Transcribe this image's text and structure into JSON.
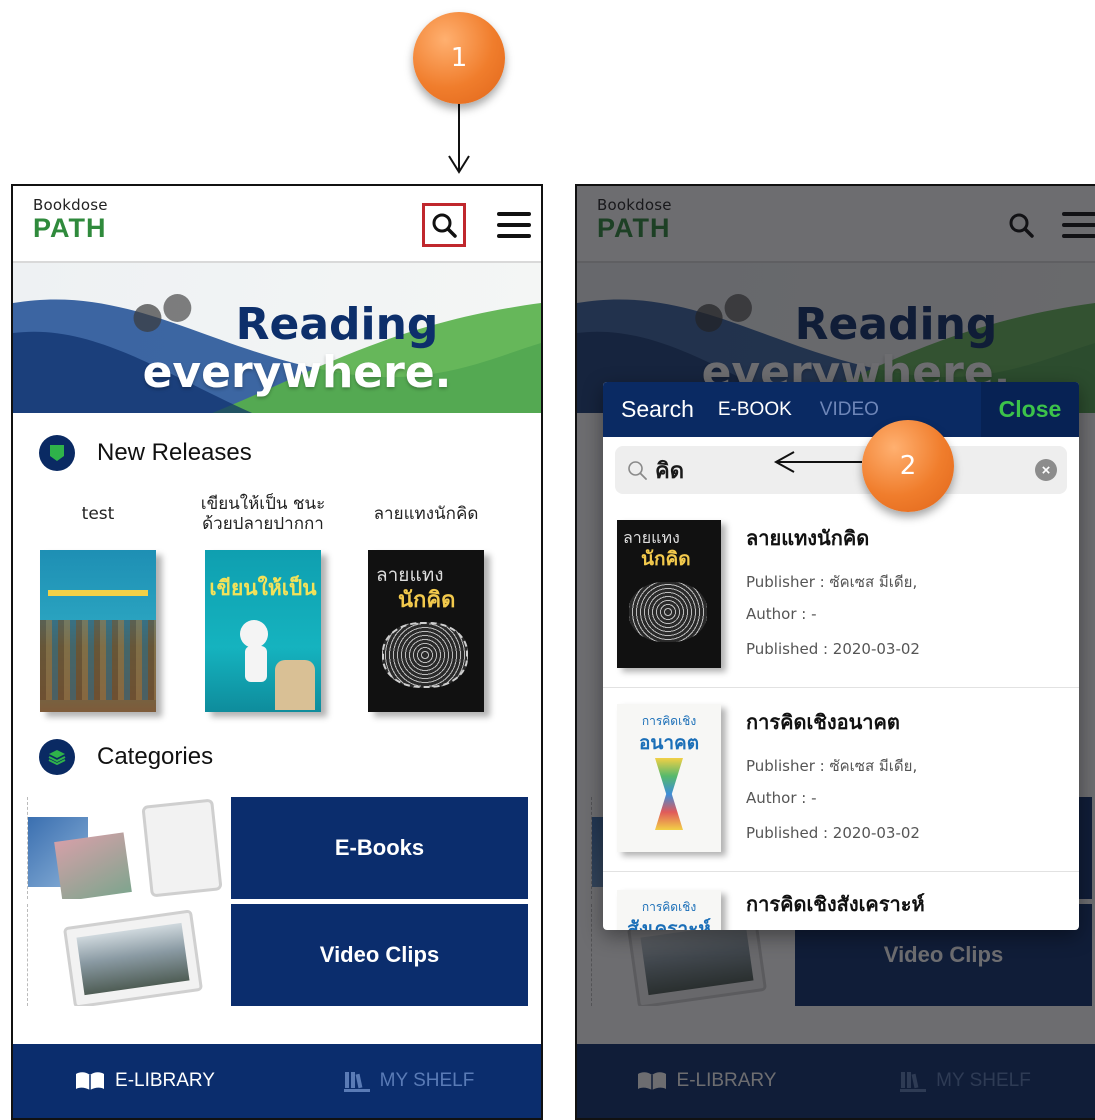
{
  "markers": {
    "step1": "1",
    "step2": "2"
  },
  "app": {
    "logo_top": "Bookdose",
    "logo_main": "PATH",
    "banner_line1": "Reading",
    "banner_line2": "everywhere."
  },
  "new_releases": {
    "heading": "New Releases",
    "books": [
      {
        "title": "test"
      },
      {
        "title": "เขียนให้เป็น ชนะด้วยปลายปากกา",
        "cover_text": "เขียนให้เป็น"
      },
      {
        "title": "ลายแทงนักคิด",
        "cover_text_1": "ลายแทง",
        "cover_text_2": "นักคิด"
      }
    ]
  },
  "categories": {
    "heading": "Categories",
    "items": [
      {
        "label": "E-Books"
      },
      {
        "label": "Video Clips"
      }
    ]
  },
  "bottom_nav": {
    "library": "E-LIBRARY",
    "shelf": "MY SHELF"
  },
  "search_modal": {
    "tab_search": "Search",
    "tab_ebook": "E-BOOK",
    "tab_video": "VIDEO",
    "close": "Close",
    "query": "คิด",
    "results": [
      {
        "title": "ลายแทงนักคิด",
        "publisher": "Publisher : ซัคเซส มีเดีย,",
        "author": "Author : -",
        "published": "Published : 2020-03-02",
        "cover_text_1": "ลายแทง",
        "cover_text_2": "นักคิด"
      },
      {
        "title": "การคิดเชิงอนาคต",
        "publisher": "Publisher : ซัคเซส มีเดีย,",
        "author": "Author : -",
        "published": "Published : 2020-03-02",
        "cover_text_1": "การคิดเชิง",
        "cover_text_2": "อนาคต"
      },
      {
        "title": "การคิดเชิงสังเคราะห์",
        "cover_text_1": "การคิดเชิง",
        "cover_text_2": "สังเคราะห์"
      }
    ]
  },
  "colors": {
    "navy": "#0b2d6d",
    "green": "#2f8a3c",
    "orange": "#f07d2c",
    "highlight": "#c0282d"
  }
}
